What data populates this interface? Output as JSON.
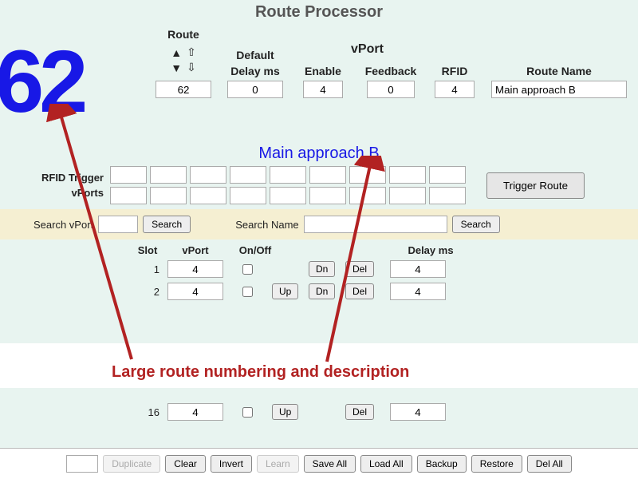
{
  "title": "Route Processor",
  "route_number_big": "62",
  "labels": {
    "route": "Route",
    "vport": "vPort",
    "default_delay": "Default",
    "default_delay2": "Delay ms",
    "enable": "Enable",
    "feedback": "Feedback",
    "rfid": "RFID",
    "route_name": "Route Name",
    "rfid_trigger": "RFID Trigger",
    "vports": "vPorts",
    "trigger_route": "Trigger Route",
    "search_vport": "Search vPort",
    "search_name": "Search Name",
    "search": "Search",
    "slot": "Slot",
    "col_vport": "vPort",
    "onoff": "On/Off",
    "delayms": "Delay ms",
    "up": "Up",
    "dn": "Dn",
    "del": "Del",
    "duplicate": "Duplicate",
    "clear": "Clear",
    "invert": "Invert",
    "learn": "Learn",
    "save_all": "Save All",
    "load_all": "Load All",
    "backup": "Backup",
    "restore": "Restore",
    "del_all": "Del All"
  },
  "header_values": {
    "route": "62",
    "default_delay": "0",
    "enable": "4",
    "feedback": "0",
    "rfid": "4",
    "route_name": "Main approach B"
  },
  "route_description": "Main approach B",
  "search": {
    "vport": "",
    "name": ""
  },
  "slots": [
    {
      "n": "1",
      "vport": "4",
      "on": false,
      "up": false,
      "dn": true,
      "del": true,
      "delay": "4"
    },
    {
      "n": "2",
      "vport": "4",
      "on": false,
      "up": true,
      "dn": true,
      "del": true,
      "delay": "4"
    },
    {
      "n": "16",
      "vport": "4",
      "on": false,
      "up": true,
      "dn": false,
      "del": true,
      "delay": "4"
    }
  ],
  "annotation": "Large route numbering and description"
}
